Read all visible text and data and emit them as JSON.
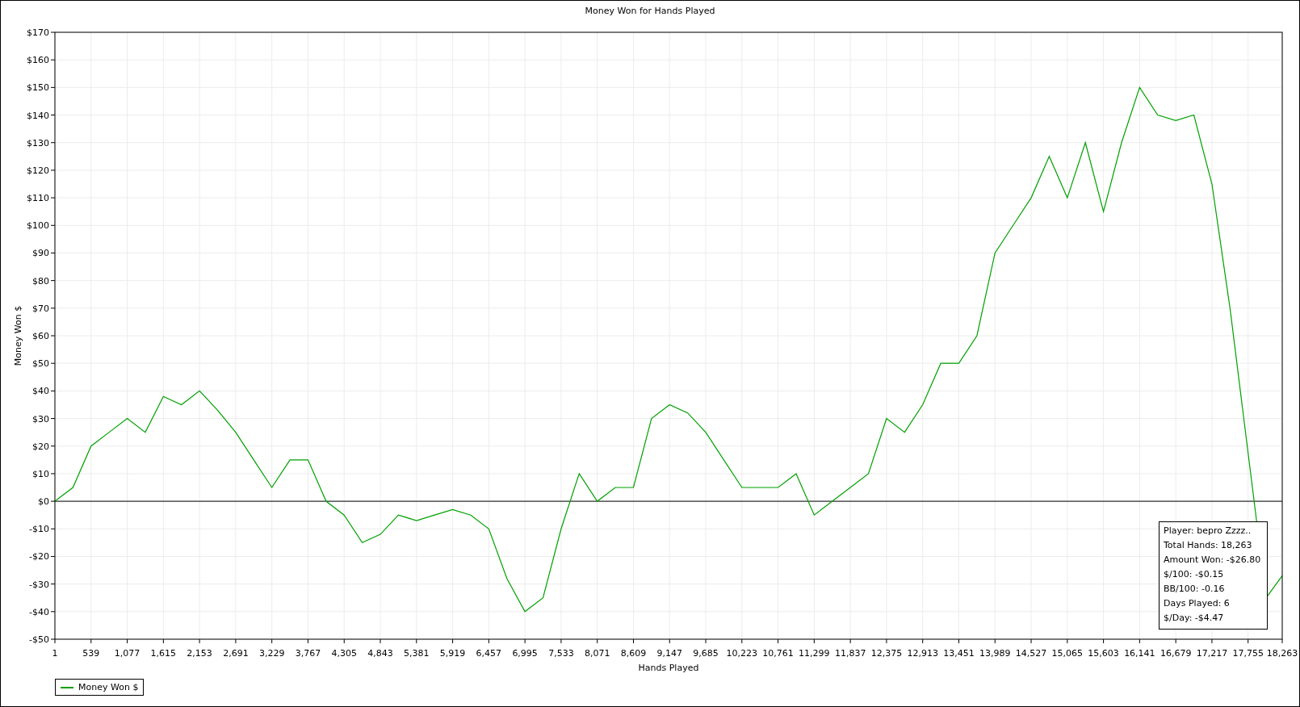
{
  "chart": {
    "chart_data": {
      "type": "line",
      "grid": true,
      "title": "Money Won for Hands Played",
      "xlabel": "Hands Played",
      "ylabel": "Money Won $",
      "x": [
        1,
        269,
        539,
        808,
        1077,
        1346,
        1615,
        1884,
        2153,
        2422,
        2691,
        2960,
        3229,
        3498,
        3767,
        4036,
        4305,
        4574,
        4843,
        5112,
        5381,
        5650,
        5919,
        6188,
        6457,
        6726,
        6995,
        7264,
        7533,
        7802,
        8071,
        8340,
        8609,
        8878,
        9147,
        9416,
        9685,
        9954,
        10223,
        10492,
        10761,
        11030,
        11299,
        11568,
        11837,
        12106,
        12375,
        12644,
        12913,
        13182,
        13451,
        13720,
        13989,
        14258,
        14527,
        14796,
        15065,
        15334,
        15603,
        15872,
        16141,
        16410,
        16679,
        16948,
        17217,
        17486,
        18024,
        18263
      ],
      "series": [
        {
          "name": "Money Won $",
          "color": "#00a000",
          "values": [
            0,
            5,
            20,
            25,
            30,
            25,
            38,
            35,
            40,
            33,
            25,
            15,
            5,
            15,
            15,
            0,
            -5,
            -15,
            -12,
            -5,
            -7,
            -5,
            -3,
            -5,
            -10,
            -28,
            -40,
            -35,
            -10,
            10,
            0,
            5,
            5,
            30,
            35,
            32,
            25,
            15,
            5,
            5,
            5,
            10,
            -5,
            0,
            5,
            10,
            30,
            25,
            35,
            50,
            50,
            60,
            90,
            100,
            110,
            125,
            110,
            130,
            105,
            130,
            150,
            140,
            138,
            140,
            115,
            70,
            -35,
            -27
          ]
        }
      ],
      "xlim": [
        1,
        18263
      ],
      "ylim": [
        -50,
        170
      ],
      "xticks": [
        {
          "value": 1,
          "label": "1"
        },
        {
          "value": 539,
          "label": "539"
        },
        {
          "value": 1077,
          "label": "1,077"
        },
        {
          "value": 1615,
          "label": "1,615"
        },
        {
          "value": 2153,
          "label": "2,153"
        },
        {
          "value": 2691,
          "label": "2,691"
        },
        {
          "value": 3229,
          "label": "3,229"
        },
        {
          "value": 3767,
          "label": "3,767"
        },
        {
          "value": 4305,
          "label": "4,305"
        },
        {
          "value": 4843,
          "label": "4,843"
        },
        {
          "value": 5381,
          "label": "5,381"
        },
        {
          "value": 5919,
          "label": "5,919"
        },
        {
          "value": 6457,
          "label": "6,457"
        },
        {
          "value": 6995,
          "label": "6,995"
        },
        {
          "value": 7533,
          "label": "7,533"
        },
        {
          "value": 8071,
          "label": "8,071"
        },
        {
          "value": 8609,
          "label": "8,609"
        },
        {
          "value": 9147,
          "label": "9,147"
        },
        {
          "value": 9685,
          "label": "9,685"
        },
        {
          "value": 10223,
          "label": "10,223"
        },
        {
          "value": 10761,
          "label": "10,761"
        },
        {
          "value": 11299,
          "label": "11,299"
        },
        {
          "value": 11837,
          "label": "11,837"
        },
        {
          "value": 12375,
          "label": "12,375"
        },
        {
          "value": 12913,
          "label": "12,913"
        },
        {
          "value": 13451,
          "label": "13,451"
        },
        {
          "value": 13989,
          "label": "13,989"
        },
        {
          "value": 14527,
          "label": "14,527"
        },
        {
          "value": 15065,
          "label": "15,065"
        },
        {
          "value": 15603,
          "label": "15,603"
        },
        {
          "value": 16141,
          "label": "16,141"
        },
        {
          "value": 16679,
          "label": "16,679"
        },
        {
          "value": 17217,
          "label": "17,217"
        },
        {
          "value": 17755,
          "label": "17,755"
        },
        {
          "value": 18263,
          "label": "18,263"
        }
      ],
      "yticks": [
        {
          "value": 170,
          "label": "$170"
        },
        {
          "value": 160,
          "label": "$160"
        },
        {
          "value": 150,
          "label": "$150"
        },
        {
          "value": 140,
          "label": "$140"
        },
        {
          "value": 130,
          "label": "$130"
        },
        {
          "value": 120,
          "label": "$120"
        },
        {
          "value": 110,
          "label": "$110"
        },
        {
          "value": 100,
          "label": "$100"
        },
        {
          "value": 90,
          "label": "$90"
        },
        {
          "value": 80,
          "label": "$80"
        },
        {
          "value": 70,
          "label": "$70"
        },
        {
          "value": 60,
          "label": "$60"
        },
        {
          "value": 50,
          "label": "$50"
        },
        {
          "value": 40,
          "label": "$40"
        },
        {
          "value": 30,
          "label": "$30"
        },
        {
          "value": 20,
          "label": "$20"
        },
        {
          "value": 10,
          "label": "$10"
        },
        {
          "value": 0,
          "label": "$0"
        },
        {
          "value": -10,
          "label": "-$10"
        },
        {
          "value": -20,
          "label": "-$20"
        },
        {
          "value": -30,
          "label": "-$30"
        },
        {
          "value": -40,
          "label": "-$40"
        },
        {
          "value": -50,
          "label": "-$50"
        }
      ]
    },
    "info_box": [
      "Player: bepro Zzzz..",
      "Total Hands: 18,263",
      "Amount Won: -$26.80",
      "$/100: -$0.15",
      "BB/100: -0.16",
      "Days Played: 6",
      "$/Day: -$4.47"
    ]
  }
}
